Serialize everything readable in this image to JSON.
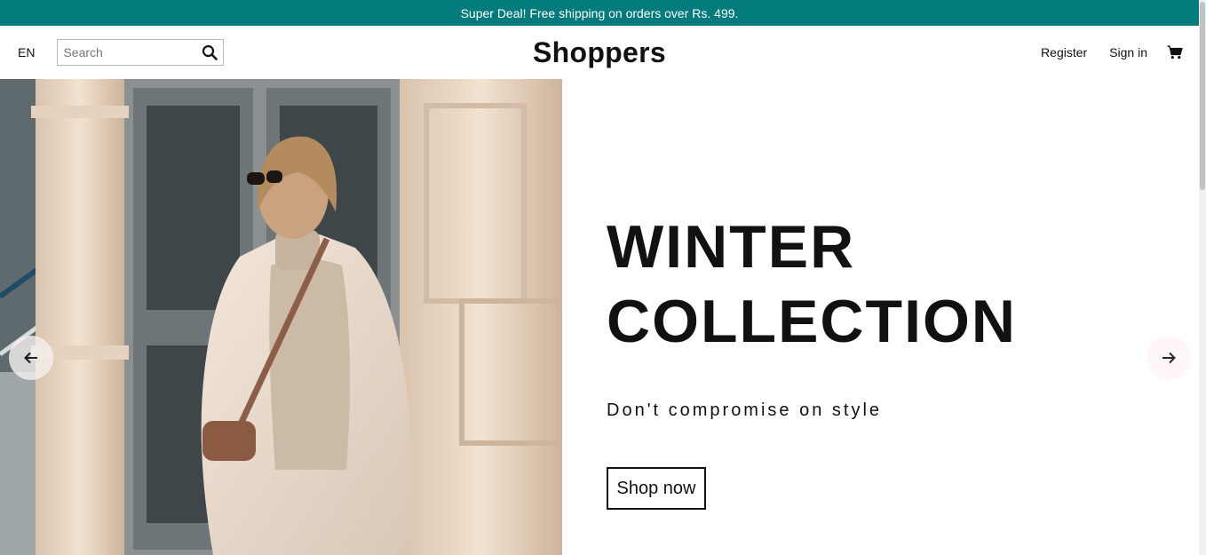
{
  "announcement": {
    "text": "Super Deal! Free shipping on orders over Rs. 499."
  },
  "navbar": {
    "language": "EN",
    "search": {
      "placeholder": "Search",
      "value": "",
      "icon": "search-icon"
    },
    "logo": "Shoppers",
    "links": {
      "register": "Register",
      "sign_in": "Sign in"
    },
    "cart_icon": "cart-icon"
  },
  "hero": {
    "title_line1": "WINTER",
    "title_line2": "COLLECTION",
    "subtitle": "Don't compromise on style",
    "button_label": "Shop now",
    "prev_icon": "arrow-left-icon",
    "next_icon": "arrow-right-icon"
  },
  "colors": {
    "announcement_bg": "#037a7c",
    "text": "#111111",
    "background": "#ffffff"
  }
}
